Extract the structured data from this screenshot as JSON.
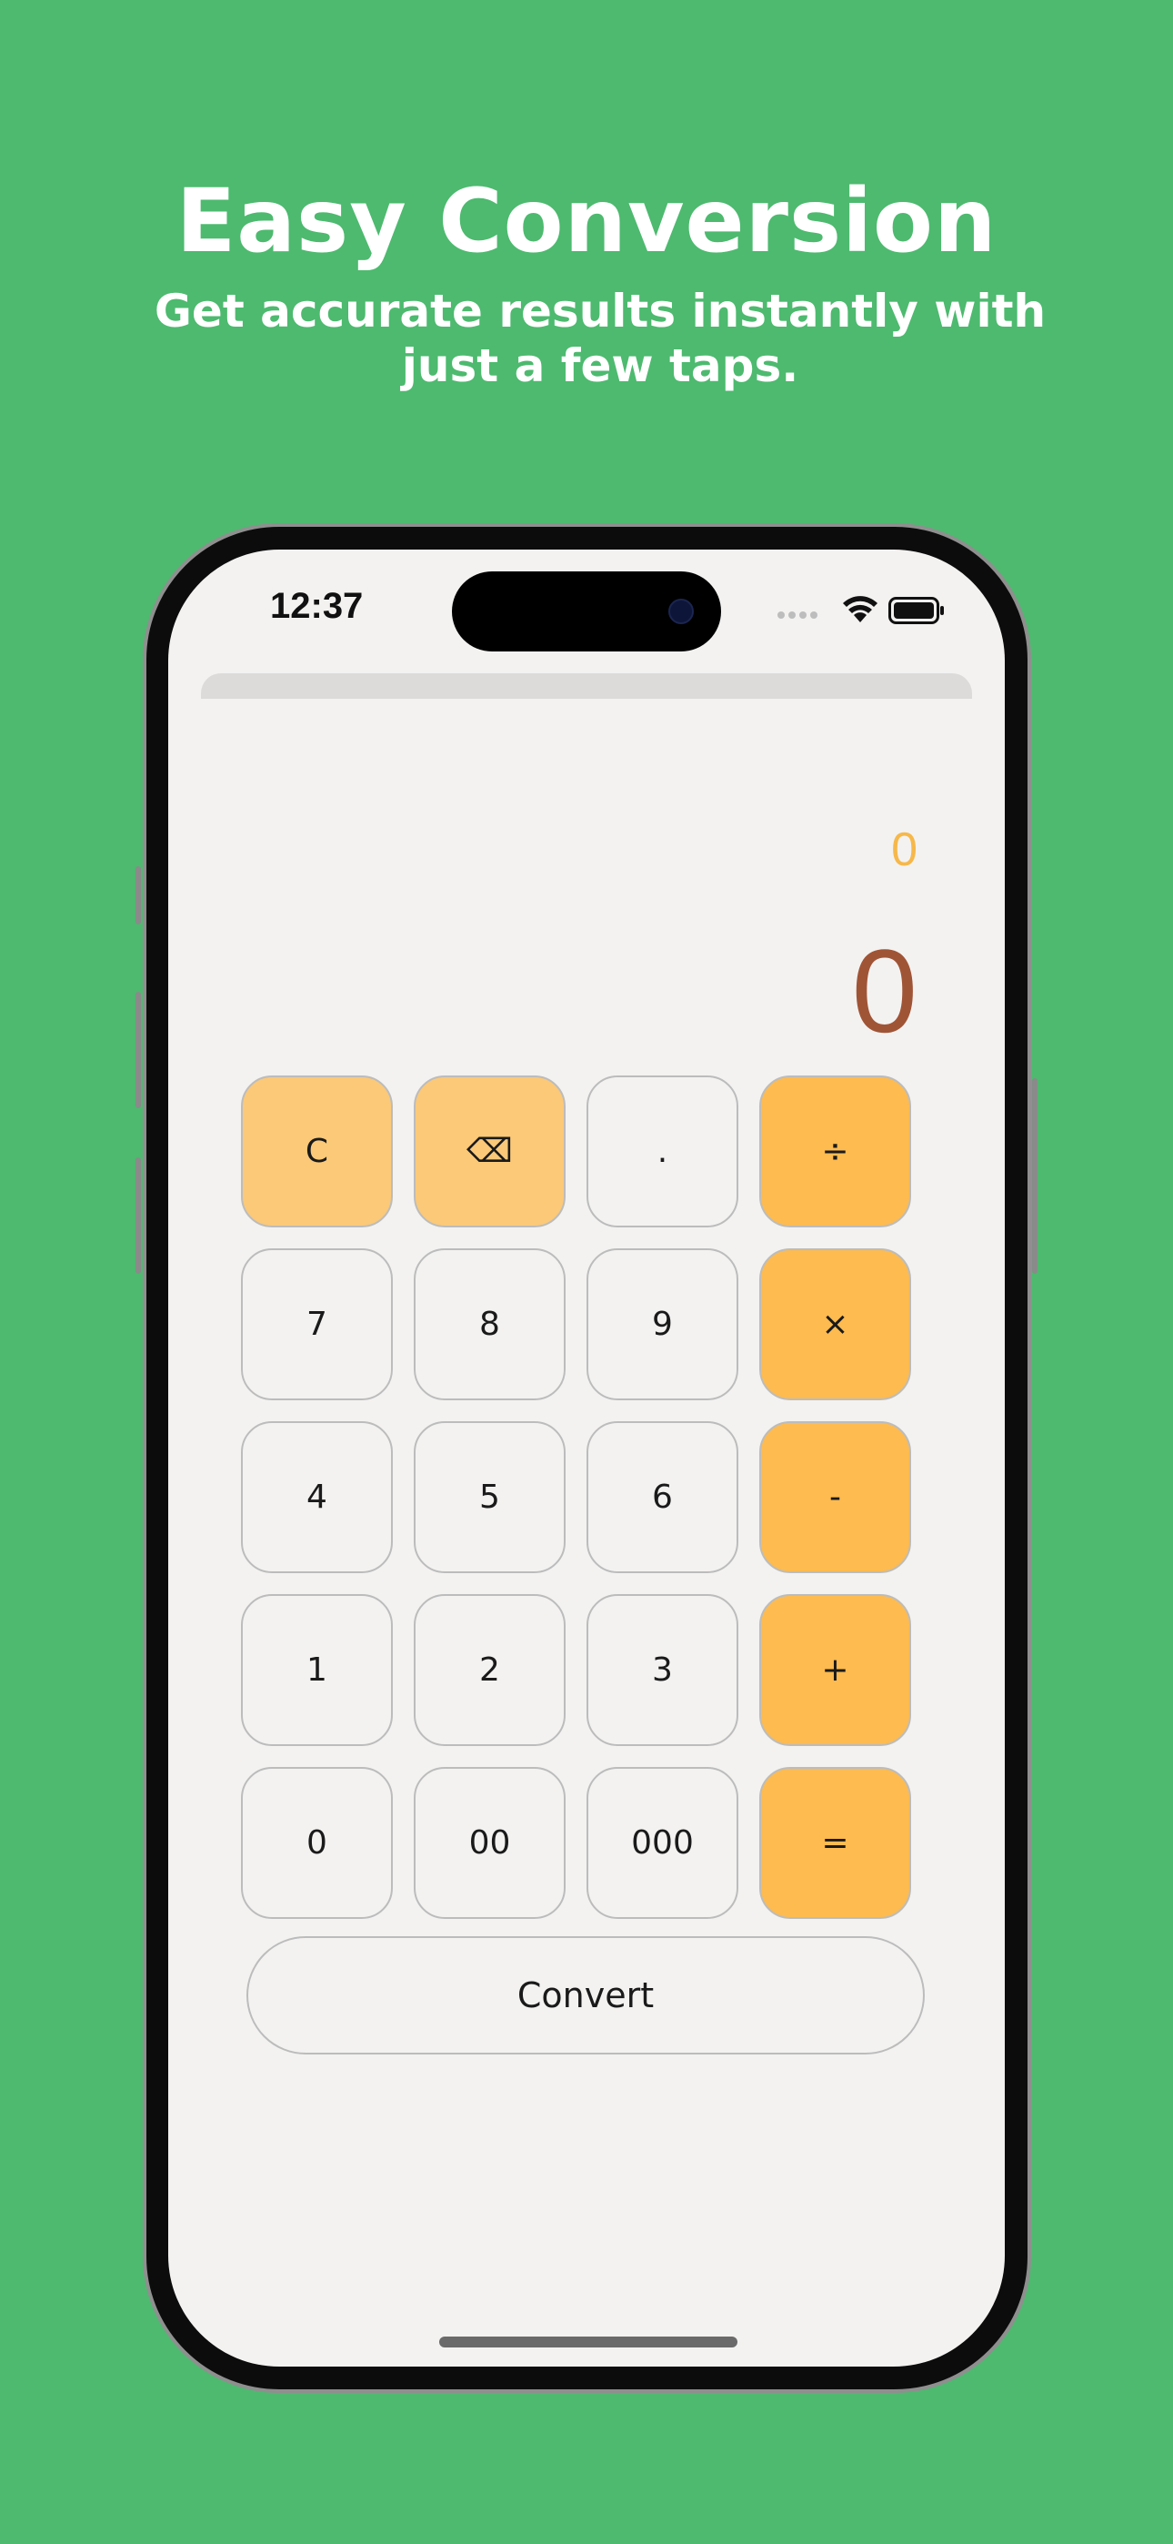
{
  "promo": {
    "headline": "Easy Conversion",
    "subhead": "Get accurate results instantly with just a few taps."
  },
  "status_bar": {
    "time": "12:37",
    "icons": [
      "signal-dots-icon",
      "wifi-icon",
      "battery-icon"
    ]
  },
  "display": {
    "secondary_value": "0",
    "primary_value": "0"
  },
  "keypad": {
    "keys": [
      {
        "label": "C",
        "name": "clear-button",
        "style": "light"
      },
      {
        "label": "⌫",
        "name": "backspace-button",
        "style": "light"
      },
      {
        "label": ".",
        "name": "decimal-button",
        "style": "plain"
      },
      {
        "label": "÷",
        "name": "divide-button",
        "style": "op"
      },
      {
        "label": "7",
        "name": "digit-7-button",
        "style": "plain"
      },
      {
        "label": "8",
        "name": "digit-8-button",
        "style": "plain"
      },
      {
        "label": "9",
        "name": "digit-9-button",
        "style": "plain"
      },
      {
        "label": "×",
        "name": "multiply-button",
        "style": "op"
      },
      {
        "label": "4",
        "name": "digit-4-button",
        "style": "plain"
      },
      {
        "label": "5",
        "name": "digit-5-button",
        "style": "plain"
      },
      {
        "label": "6",
        "name": "digit-6-button",
        "style": "plain"
      },
      {
        "label": "-",
        "name": "subtract-button",
        "style": "op"
      },
      {
        "label": "1",
        "name": "digit-1-button",
        "style": "plain"
      },
      {
        "label": "2",
        "name": "digit-2-button",
        "style": "plain"
      },
      {
        "label": "3",
        "name": "digit-3-button",
        "style": "plain"
      },
      {
        "label": "+",
        "name": "add-button",
        "style": "op"
      },
      {
        "label": "0",
        "name": "digit-0-button",
        "style": "plain"
      },
      {
        "label": "00",
        "name": "double-zero-button",
        "style": "plain"
      },
      {
        "label": "000",
        "name": "triple-zero-button",
        "style": "plain"
      },
      {
        "label": "=",
        "name": "equals-button",
        "style": "op"
      }
    ]
  },
  "convert_button": {
    "label": "Convert"
  },
  "colors": {
    "background": "#4dba6f",
    "key_light": "#fbc978",
    "key_operator": "#fdbb50",
    "display_secondary": "#f6b84a",
    "display_primary": "#a05436"
  }
}
